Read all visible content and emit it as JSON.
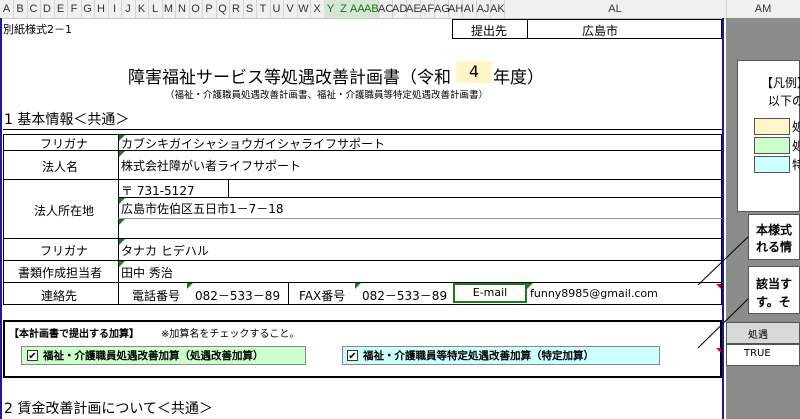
{
  "columns": [
    "A",
    "B",
    "C",
    "D",
    "E",
    "F",
    "G",
    "H",
    "I",
    "J",
    "K",
    "L",
    "M",
    "N",
    "O",
    "P",
    "Q",
    "R",
    "S",
    "T",
    "U",
    "V",
    "W",
    "X",
    "Y",
    "Z",
    "AA",
    "AB",
    "AC",
    "AD",
    "AE",
    "AF",
    "AG",
    "AH",
    "AI",
    "AJ",
    "AK",
    "AL",
    "AM"
  ],
  "selected_columns": [
    "Y",
    "Z",
    "AA",
    "AB"
  ],
  "form_code": "別紙様式2－1",
  "submit_label": "提出先",
  "submit_value": "広島市",
  "title": "障害福祉サービス等処遇改善計画書（令和",
  "title_year": "4",
  "title_suffix": "年度）",
  "subtitle": "（福祉・介護職員処遇改善計画書、福祉・介護職員等特定処遇改善計画書）",
  "section1": "1  基本情報＜共通＞",
  "rows": {
    "furigana_label": "フリガナ",
    "furigana_value": "カブシキガイシャショウガイシャライフサポート",
    "corp_name_label": "法人名",
    "corp_name_value": "株式会社障がい者ライフサポート",
    "address_label": "法人所在地",
    "postal": "〒 731-5127",
    "address_value": "広島市佐伯区五日市1－7－18",
    "author_furigana_label": "フリガナ",
    "author_furigana_value": "タナカ ヒデハル",
    "author_label": "書類作成担当者",
    "author_value": "田中  秀治",
    "contact_label": "連絡先",
    "phone_label": "電話番号",
    "phone_value": "082－533－89",
    "fax_label": "FAX番号",
    "fax_value": "082－533－89",
    "email_label": "E-mail",
    "email_value": "funny8985@gmail.com"
  },
  "addition_heading": "【本計画書で提出する加算】",
  "addition_note": "※加算名をチェックすること。",
  "addition1": "福祉・介護職員処遇改善加算（処遇改善加算）",
  "addition2": "福祉・介護職員等特定処遇改善加算（特定加算）",
  "section2": "2  賃金改善計画について＜共通＞",
  "right_panel": {
    "legend_title": "【凡例】",
    "legend_sub": "以下の",
    "legend_items": [
      "処",
      "処",
      "特"
    ],
    "legend_colors": [
      "#fff5c8",
      "#ccffcc",
      "#ccffff"
    ],
    "note1_line1": "本様式",
    "note1_line2": "れる情",
    "note2_line1": "該当す",
    "note2_line2": "す。そ",
    "table_header": "処遇",
    "table_value": "TRUE"
  },
  "colors": {
    "addition1_bg": "#ccffcc",
    "addition2_bg": "#ccffff",
    "year_bg": "#fff5c8",
    "sheet_border": "#1a1aa0"
  }
}
